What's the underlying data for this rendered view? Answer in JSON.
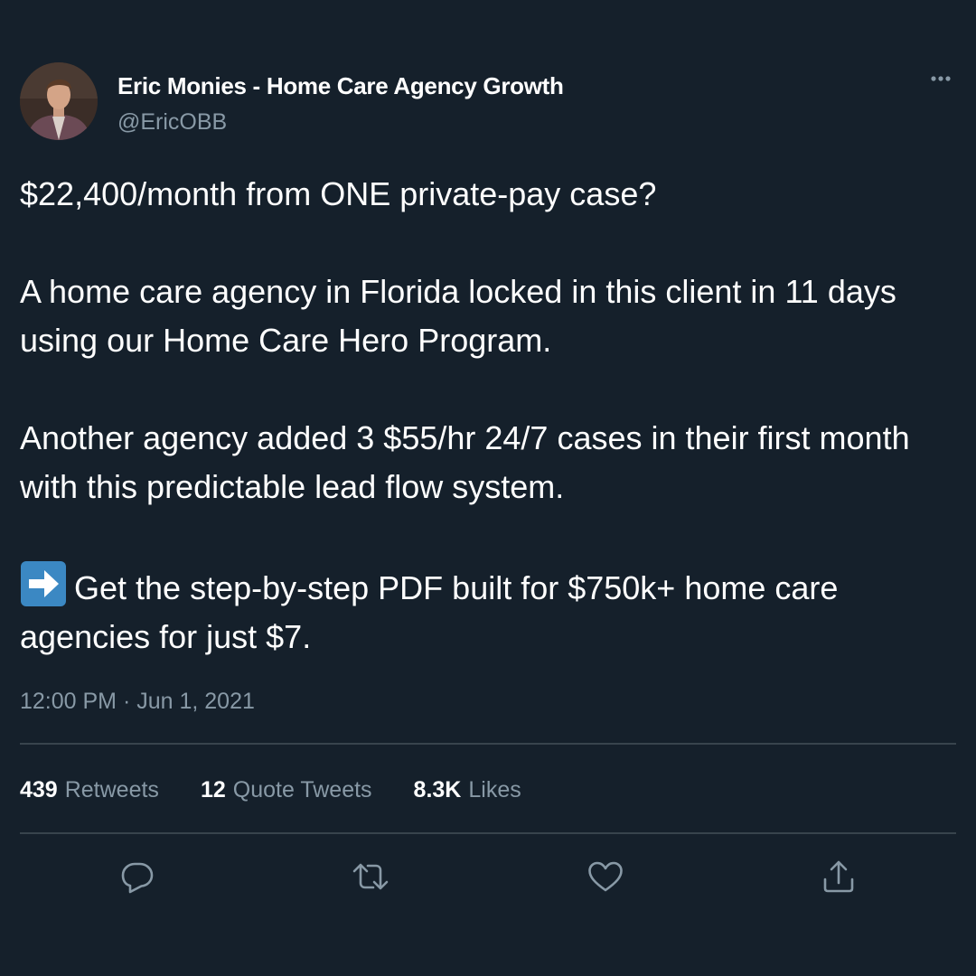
{
  "author": {
    "name": "Eric Monies - Home Care Agency Growth",
    "handle": "@EricOBB",
    "avatar_icon": "profile-photo"
  },
  "more_icon": "ellipsis-icon",
  "tweet": {
    "paragraphs": [
      "$22,400/month from ONE private-pay case?",
      "A home care agency in Florida locked in this client in 11 days using our Home Care Hero Program.",
      "Another agency added 3 $55/hr 24/7 cases in their first month with this predictable lead flow system."
    ],
    "cta_emoji": "right-arrow-emoji",
    "cta_text": "Get the step-by-step PDF built for $750k+ home care agencies for just $7."
  },
  "timestamp": "12:00 PM · Jun 1, 2021",
  "stats": {
    "retweets": {
      "count": "439",
      "label": "Retweets"
    },
    "quotes": {
      "count": "12",
      "label": "Quote Tweets"
    },
    "likes": {
      "count": "8.3K",
      "label": "Likes"
    }
  },
  "actions": {
    "reply_icon": "reply-icon",
    "retweet_icon": "retweet-icon",
    "like_icon": "heart-icon",
    "share_icon": "share-icon"
  },
  "colors": {
    "background": "#15202b",
    "text_primary": "#ffffff",
    "text_secondary": "#8899a6",
    "divider": "#38444d",
    "emoji_blue": "#3b88c3"
  }
}
